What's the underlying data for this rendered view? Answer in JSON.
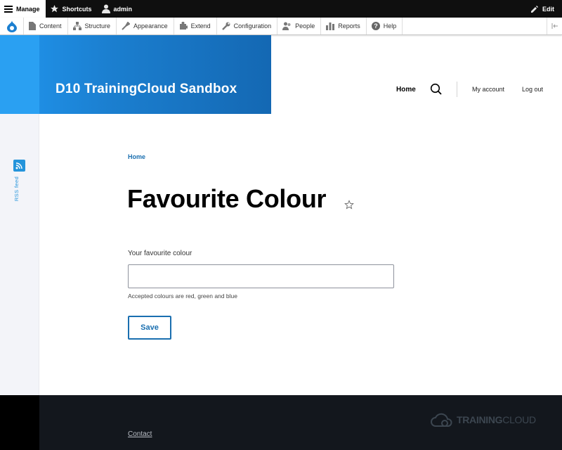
{
  "admin_bar": {
    "manage": "Manage",
    "shortcuts": "Shortcuts",
    "user": "admin",
    "edit": "Edit"
  },
  "admin_menu": [
    {
      "label": "Content",
      "icon": "content-icon"
    },
    {
      "label": "Structure",
      "icon": "structure-icon"
    },
    {
      "label": "Appearance",
      "icon": "appearance-icon"
    },
    {
      "label": "Extend",
      "icon": "extend-icon"
    },
    {
      "label": "Configuration",
      "icon": "configuration-icon"
    },
    {
      "label": "People",
      "icon": "people-icon"
    },
    {
      "label": "Reports",
      "icon": "reports-icon"
    },
    {
      "label": "Help",
      "icon": "help-icon"
    }
  ],
  "header": {
    "site_name": "D10 TrainingCloud Sandbox",
    "nav": {
      "home": "Home",
      "my_account": "My account",
      "log_out": "Log out"
    }
  },
  "sidebar": {
    "rss_label": "RSS feed"
  },
  "main": {
    "breadcrumb": "Home",
    "title": "Favourite Colour",
    "form": {
      "label": "Your favourite colour",
      "value": "",
      "description": "Accepted colours are red, green and blue",
      "save": "Save"
    }
  },
  "footer": {
    "contact": "Contact",
    "logo_part1": "TRAINING",
    "logo_part2": "CLOUD"
  },
  "colors": {
    "brand_blue": "#1b7fd0",
    "link_blue": "#1a6fb0",
    "footer_bg": "#13171d"
  }
}
